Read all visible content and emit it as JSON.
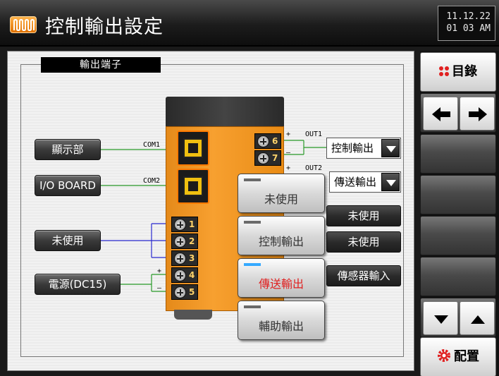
{
  "header": {
    "title": "控制輸出設定",
    "date": "11.12.22",
    "time": "01 03 AM"
  },
  "panel": {
    "group_title": "輸出端子",
    "left_buttons": {
      "display": "顯示部",
      "io_board": "I/O BOARD",
      "unused": "未使用",
      "power": "電源(DC15)"
    },
    "port_labels": {
      "com1": "COM1",
      "com2": "COM2"
    },
    "out_labels": {
      "out1": "OUT1",
      "out2": "OUT2",
      "plus": "+",
      "minus": "–"
    },
    "terminals_right": [
      "6",
      "7"
    ],
    "terminals_left": [
      "1",
      "2",
      "3",
      "4",
      "5"
    ],
    "out1_select": "控制輸出",
    "out2_select": "傳送輸出",
    "status_boxes": [
      "未使用",
      "未使用",
      "傳感器輸入"
    ]
  },
  "popup_menu": {
    "items": [
      {
        "label": "未使用",
        "active": false
      },
      {
        "label": "控制輸出",
        "active": false
      },
      {
        "label": "傳送輸出",
        "active": true
      },
      {
        "label": "輔助輸出",
        "active": false
      }
    ]
  },
  "sidebar": {
    "menu_label": "目錄",
    "config_label": "配置"
  },
  "colors": {
    "accent_orange": "#f7a030",
    "wire_green": "#2a9a2a",
    "wire_blue": "#2a2ad0",
    "active_red": "#e02020",
    "indicator_blue": "#35a9ff"
  }
}
